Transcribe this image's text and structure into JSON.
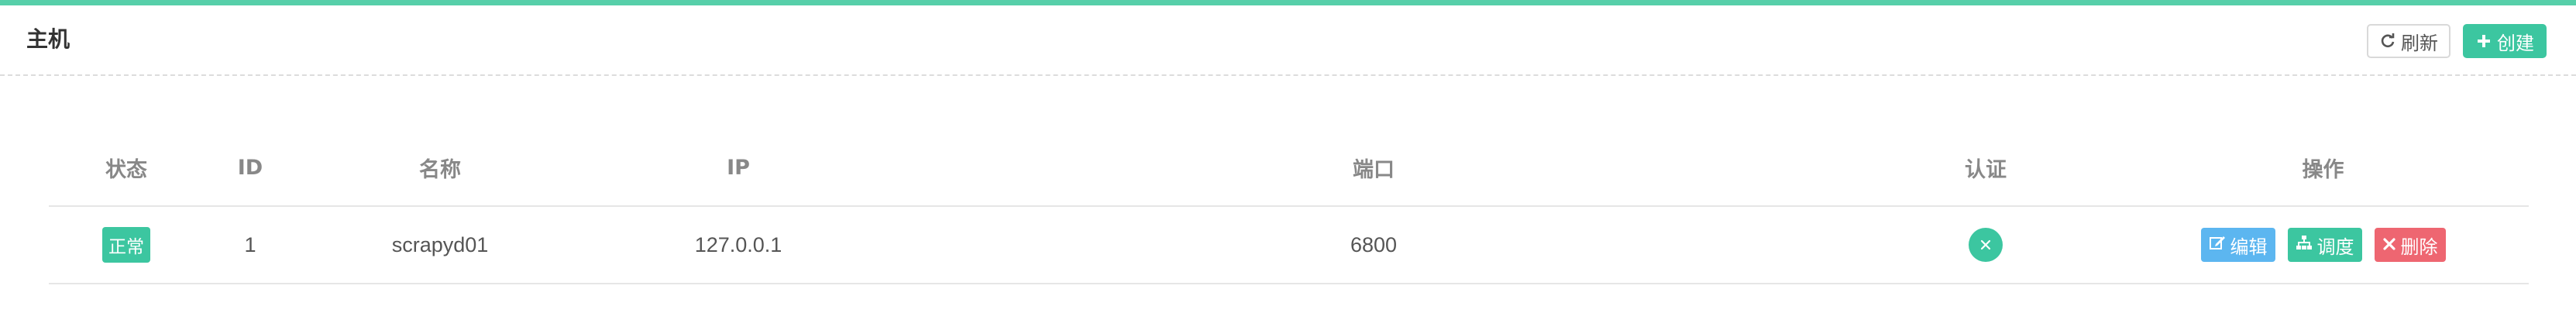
{
  "panel": {
    "title": "主机",
    "refresh_label": "刷新",
    "create_label": "创建"
  },
  "table": {
    "headers": {
      "status": "状态",
      "id": "ID",
      "name": "名称",
      "ip": "IP",
      "port": "端口",
      "auth": "认证",
      "actions": "操作"
    },
    "rows": [
      {
        "status": "正常",
        "id": "1",
        "name": "scrapyd01",
        "ip": "127.0.0.1",
        "port": "6800",
        "auth_icon": "close-icon",
        "edit_label": "编辑",
        "dispatch_label": "调度",
        "delete_label": "删除"
      }
    ]
  },
  "colors": {
    "accent": "#3cc6a0",
    "top_bar": "#57cfa9",
    "edit": "#5cb6f0",
    "delete": "#ee6671"
  }
}
